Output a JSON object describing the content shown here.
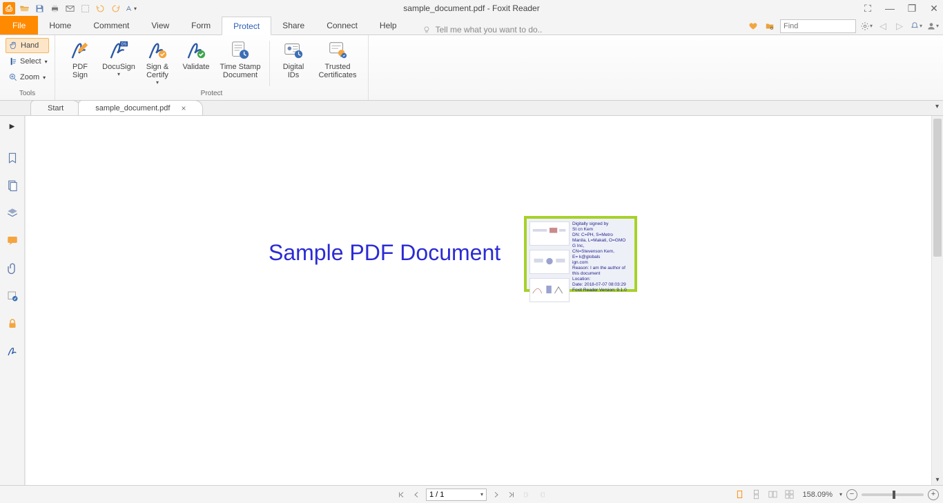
{
  "app": {
    "title": "sample_document.pdf - Foxit Reader"
  },
  "qat": {
    "openLabel": "Open",
    "saveLabel": "Save",
    "printLabel": "Print",
    "emailLabel": "Email",
    "clipboardLabel": "Snapshot",
    "undoLabel": "Undo",
    "redoLabel": "Redo",
    "typewriterLabel": "Typewriter"
  },
  "menu": {
    "file": "File",
    "home": "Home",
    "comment": "Comment",
    "view": "View",
    "form": "Form",
    "protect": "Protect",
    "share": "Share",
    "connect": "Connect",
    "help": "Help",
    "tellme": "Tell me what you want to do..",
    "findPlaceholder": "Find"
  },
  "tools": {
    "hand": "Hand",
    "select": "Select",
    "zoom": "Zoom",
    "groupLabel": "Tools"
  },
  "ribbon": {
    "pdfsign": "PDF\nSign",
    "docusign": "DocuSign",
    "signcertify": "Sign &\nCertify",
    "validate": "Validate",
    "timestamp": "Time Stamp\nDocument",
    "digitalids": "Digital\nIDs",
    "trusted": "Trusted\nCertificates",
    "protectGroup": "Protect"
  },
  "doctabs": {
    "start": "Start",
    "current": "sample_document.pdf"
  },
  "document": {
    "heading": "Sample PDF Document",
    "signature": {
      "l1": "Digitally signed by",
      "l2": "St         cn Kem",
      "l3": "DN: C=PH, S=Metro",
      "l4": "Manila, L=Makati, O=GMO",
      "l5": "G            Inc,",
      "l6": "CN=Stevenson Kem,",
      "l7": "E=                 k@globals",
      "l8": "ign.com",
      "l9": "Reason: I am the author of",
      "l10": "this document",
      "l11": "Location:",
      "l12": "Date: 2018-07-07 08:03:29",
      "l13": "Foxit Reader Version: 9.1.0"
    }
  },
  "status": {
    "page": "1 / 1",
    "zoom": "158.09%"
  }
}
